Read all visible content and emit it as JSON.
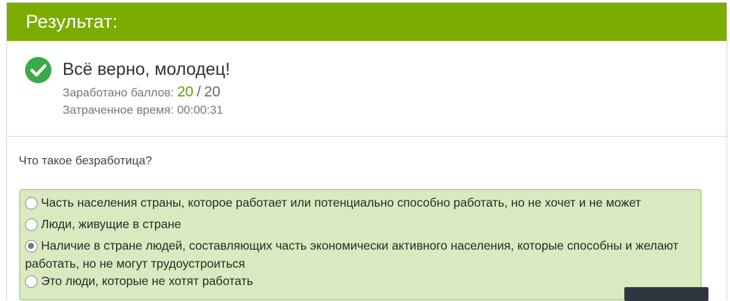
{
  "header": {
    "title": "Результат:"
  },
  "summary": {
    "title": "Всё верно, молодец!",
    "score_label": "Заработано баллов:",
    "score_value": "20",
    "score_separator": "/",
    "score_total": "20",
    "time_label": "Затраченное время:",
    "time_value": "00:00:31"
  },
  "question": {
    "text": "Что такое безработица?"
  },
  "answers": [
    {
      "label": "Часть населения страны, которое работает или потенциально способно работать, но не хочет и не может",
      "selected": false
    },
    {
      "label": "Люди, живущие в стране",
      "selected": false
    },
    {
      "label": "Наличие в стране людей, составляющих часть экономически активного населения, которые способны и желают работать, но не могут трудоустроиться",
      "selected": true
    },
    {
      "label": "Это люди, которые не хотят работать",
      "selected": false
    }
  ],
  "colors": {
    "header_bg": "#7aad00",
    "answers_bg": "#d9eac0",
    "check_bg": "#3aaa4a",
    "score_accent": "#57a800"
  }
}
